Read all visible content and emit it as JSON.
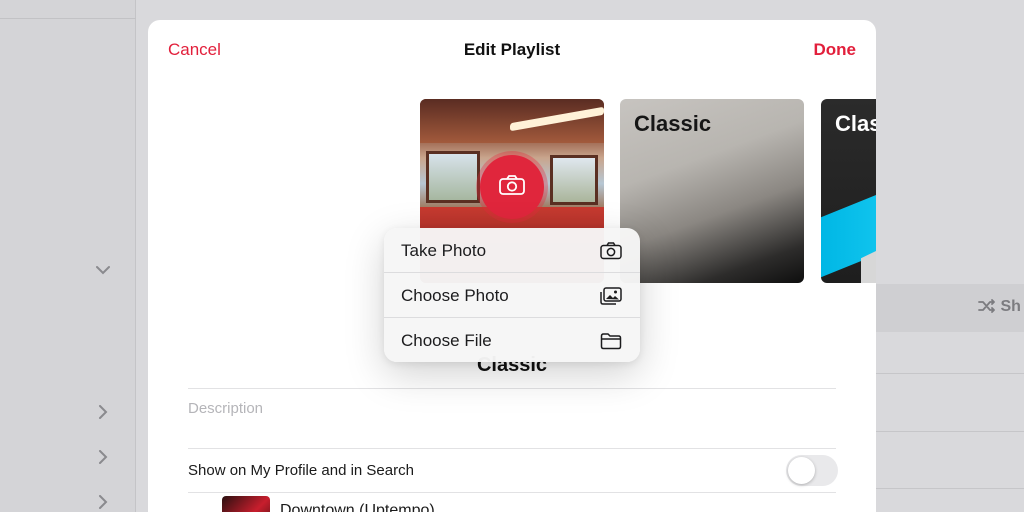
{
  "header": {
    "cancel_label": "Cancel",
    "title": "Edit Playlist",
    "done_label": "Done"
  },
  "artwork": {
    "options": [
      {
        "label": "Classic"
      },
      {
        "label": "Classic"
      }
    ]
  },
  "menu": {
    "items": [
      {
        "label": "Take Photo",
        "icon": "camera-icon"
      },
      {
        "label": "Choose Photo",
        "icon": "photo-library-icon"
      },
      {
        "label": "Choose File",
        "icon": "folder-icon"
      }
    ]
  },
  "playlist": {
    "name": "Classic",
    "description_placeholder": "Description",
    "profile_toggle_label": "Show on My Profile and in Search",
    "profile_toggle_on": false
  },
  "songs": [
    {
      "title": "Downtown (Uptempo)"
    }
  ],
  "background": {
    "shuffle_label": "Sh"
  },
  "colors": {
    "accent": "#e21f3b"
  }
}
